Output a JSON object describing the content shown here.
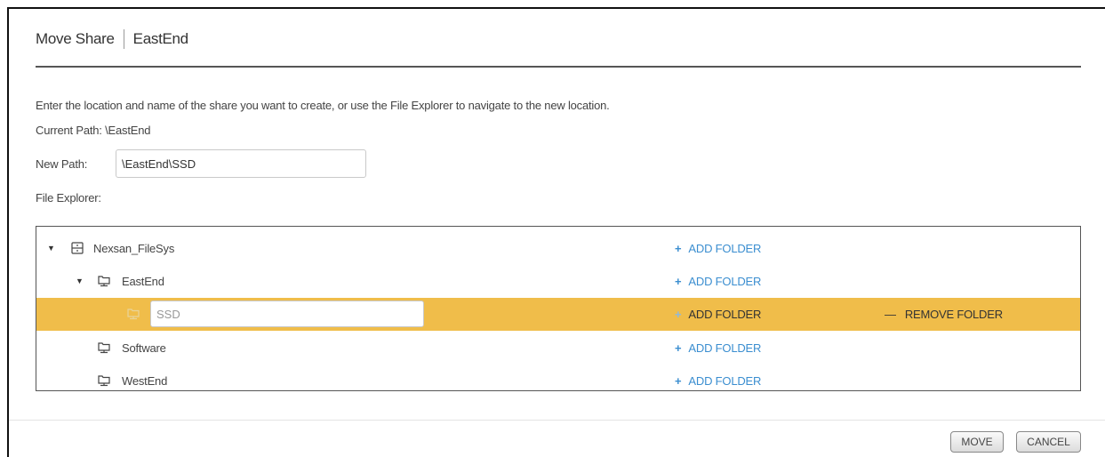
{
  "dialog": {
    "title": "Move Share",
    "subtitle": "EastEnd",
    "intro": "Enter the location and name of the share you want to create, or use the File Explorer to navigate to the new location.",
    "current_path": "Current Path: \\EastEnd",
    "new_path_label": "New Path:",
    "new_path_value": "\\EastEnd\\SSD",
    "file_explorer_label": "File Explorer:"
  },
  "tree": {
    "add_folder_label": "ADD FOLDER",
    "remove_folder_label": "REMOVE FOLDER",
    "add_icon": "+",
    "remove_icon": "—",
    "rows": [
      {
        "name": "Nexsan_FileSys",
        "icon": "filesystem-icon",
        "expanded": true
      },
      {
        "name": "EastEnd",
        "icon": "share-folder-icon",
        "expanded": true
      },
      {
        "name": "SSD",
        "icon": "share-folder-icon",
        "editing": true,
        "selected": true
      },
      {
        "name": "Software",
        "icon": "share-folder-icon"
      },
      {
        "name": "WestEnd",
        "icon": "share-folder-icon"
      }
    ]
  },
  "buttons": {
    "move": "MOVE",
    "cancel": "CANCEL"
  },
  "colors": {
    "selected_row": "#f0bd4a",
    "link_blue": "#3b8ed0"
  }
}
